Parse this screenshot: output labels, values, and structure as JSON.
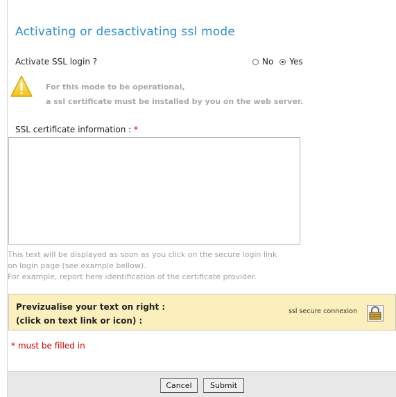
{
  "title": "Activating or desactivating ssl mode",
  "ssl_login": {
    "label": "Activate SSL login ?",
    "options": [
      "No",
      "Yes"
    ],
    "selected": "Yes"
  },
  "warning": {
    "icon": "warning-icon",
    "line1": "For this mode to be operational,",
    "line2": "a ssl certificate must be installed by you on the web server."
  },
  "certificate": {
    "label": "SSL certificate information :",
    "required_mark": "*",
    "value": "",
    "help": "This text will be displayed as soon as you click on the secure login link\non login page (see example bellow).\nFor example, report here identification of the certificate provider."
  },
  "preview": {
    "line1": "Previzualise your text on right :",
    "line2": "(click on text link or icon) :",
    "link_text": "ssl secure connexion",
    "icon": "lock-icon",
    "background": "#fbefbd"
  },
  "required_note": "* must be filled in",
  "buttons": {
    "cancel": "Cancel",
    "submit": "Submit"
  },
  "colors": {
    "title": "#2f8fcf",
    "required": "#cc0000"
  }
}
